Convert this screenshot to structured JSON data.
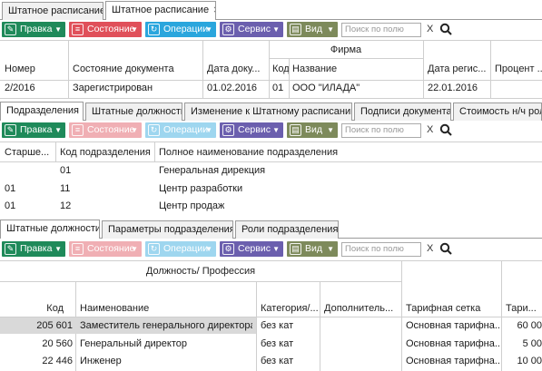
{
  "top_tabs": [
    "Штатное расписание",
    "Штатное расписание"
  ],
  "toolbar": {
    "edit": "Правка",
    "state": "Состояние",
    "ops": "Операции",
    "service": "Сервис",
    "view": "Вид",
    "search_placeholder": "Поиск по полю",
    "clear": "X"
  },
  "doc_grid": {
    "group_header": "Фирма",
    "columns": [
      "Номер",
      "Состояние документа",
      "Дата доку...",
      "Код",
      "Название",
      "Дата регис...",
      "Процент ..."
    ],
    "row": [
      "2/2016",
      "Зарегистрирован",
      "01.02.2016",
      "01",
      "ООО \"ИЛАДА\"",
      "22.01.2016",
      ""
    ]
  },
  "mid_tabs": [
    "Подразделения",
    "Штатные должности",
    "Изменение к Штатному расписанию",
    "Подписи документа",
    "Стоимость н/ч роле"
  ],
  "div_grid": {
    "columns": [
      "Старше...",
      "Код подразделения",
      "Полное наименование подразделения"
    ],
    "rows": [
      [
        "",
        "01",
        "Генеральная дирекция"
      ],
      [
        "01",
        "11",
        "Центр разработки"
      ],
      [
        "01",
        "12",
        "Центр продаж"
      ]
    ]
  },
  "bottom_tabs": [
    "Штатные должности",
    "Параметры подразделения",
    "Роли подразделения"
  ],
  "pos_grid": {
    "group_header": "Должность/ Профессия",
    "columns": [
      "Код",
      "Наименование",
      "Категория/...",
      "Дополнитель...",
      "Тарифная сетка",
      "Тари..."
    ],
    "rows": [
      [
        "205 601",
        "Заместитель генерального директора",
        "без кат",
        "",
        "Основная тарифна...",
        "60 00"
      ],
      [
        "20 560",
        "Генеральный директор",
        "без кат",
        "",
        "Основная тарифна...",
        "5 00"
      ],
      [
        "22 446",
        "Инженер",
        "без кат",
        "",
        "Основная тарифна...",
        "10 00"
      ]
    ]
  },
  "colors": {
    "edit": "#1f8a5a",
    "state": "#e0505a",
    "ops": "#2aa6dd",
    "service": "#6b5fae",
    "view": "#7d8a5b"
  }
}
